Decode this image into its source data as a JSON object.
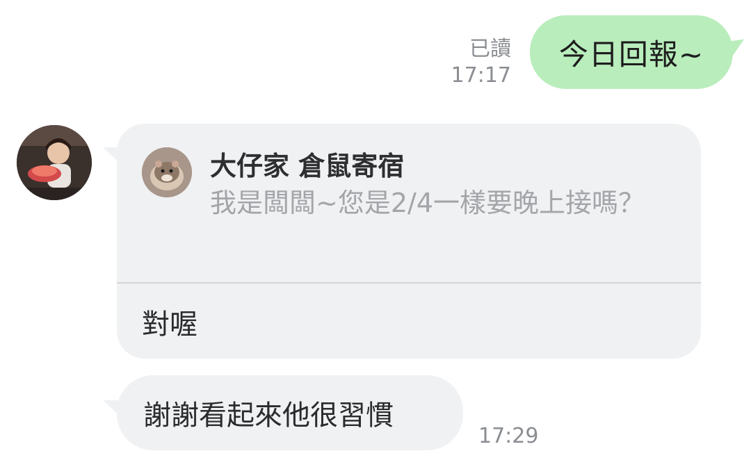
{
  "outgoing": {
    "text": "今日回報~",
    "read_label": "已讀",
    "time": "17:17",
    "bubble_color": "#b9edbc"
  },
  "incoming_reply": {
    "quoted_name": "大仔家 倉鼠寄宿",
    "quoted_text": "我是闆闆~您是2/4一樣要晚上接嗎？",
    "reply_text": "對喔",
    "bubble_color": "#f0f1f3"
  },
  "incoming_second": {
    "text": "謝謝看起來他很習慣",
    "time": "17:29"
  },
  "icons": {
    "sender_avatar": "user-avatar-photo",
    "quoted_avatar": "hamster-avatar-photo"
  }
}
